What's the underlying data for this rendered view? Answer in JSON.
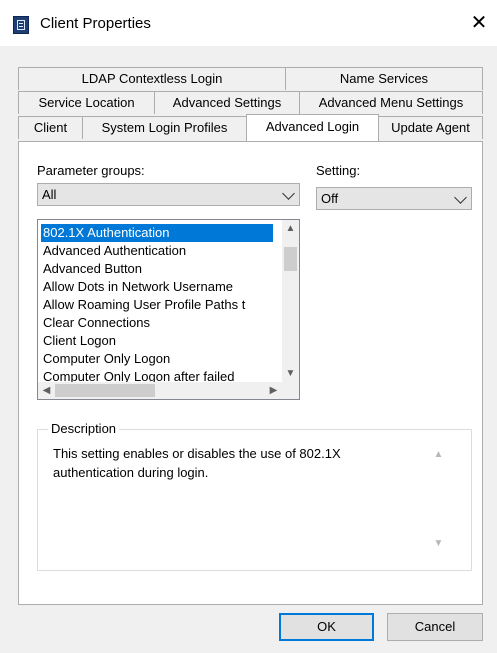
{
  "window": {
    "title": "Client Properties",
    "close_glyph": "✕"
  },
  "tabs": {
    "row1": [
      "LDAP Contextless Login",
      "Name Services"
    ],
    "row2": [
      "Service Location",
      "Advanced Settings",
      "Advanced Menu Settings"
    ],
    "row3": [
      "Client",
      "System Login Profiles",
      "Advanced Login",
      "Update Agent"
    ],
    "active": "Advanced Login"
  },
  "parameter_groups": {
    "label": "Parameter groups:",
    "selected": "All"
  },
  "setting": {
    "label": "Setting:",
    "selected": "Off"
  },
  "parameters": {
    "items": [
      "802.1X Authentication",
      "Advanced Authentication",
      "Advanced Button",
      "Allow Dots in Network Username",
      "Allow Roaming User Profile Paths t",
      "Clear Connections",
      "Client Logon",
      "Computer Only Logon",
      "Computer Only Logon after failed"
    ],
    "selected": "802.1X Authentication"
  },
  "description": {
    "legend": "Description",
    "text": "This setting enables or disables the use of 802.1X authentication during login."
  },
  "buttons": {
    "ok": "OK",
    "cancel": "Cancel"
  },
  "icons": [
    "app-icon",
    "close-icon",
    "chevron-down-icon",
    "scroll-up-icon",
    "scroll-down-icon",
    "scroll-left-icon",
    "scroll-right-icon"
  ],
  "colors": {
    "selection": "#0078d7",
    "dialog_bg": "#f0f0f0",
    "default_button_border": "#0078d7"
  }
}
